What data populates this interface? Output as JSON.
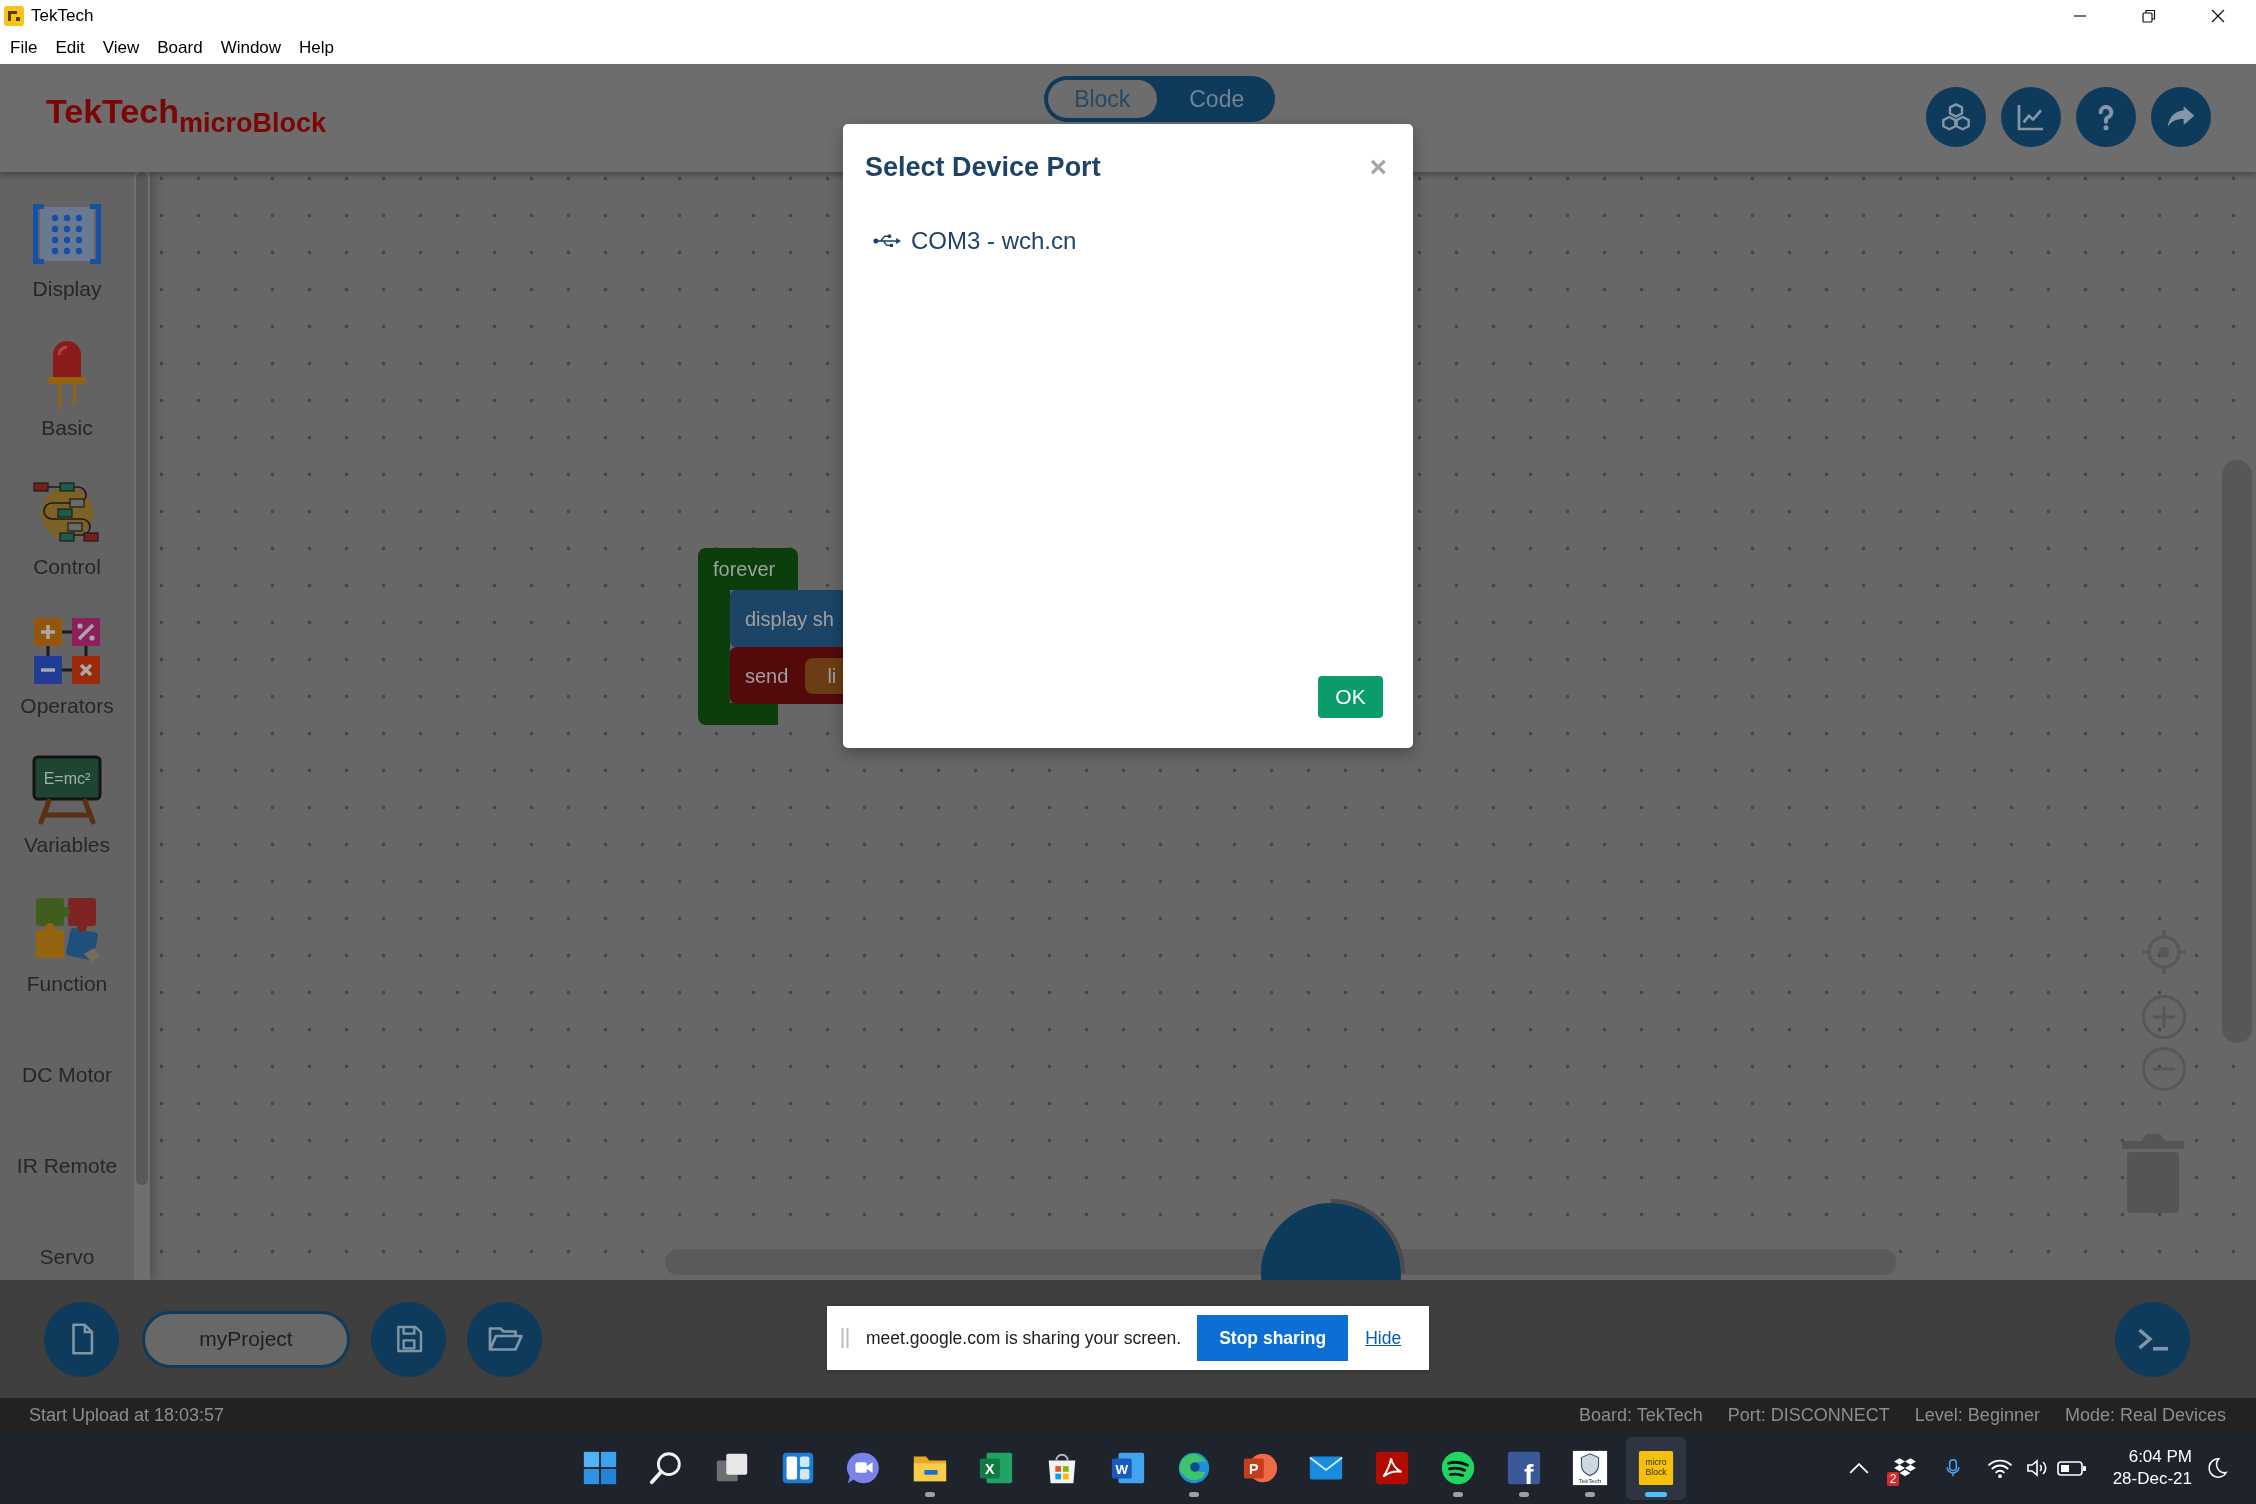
{
  "window": {
    "title": "TekTech"
  },
  "menu": [
    "File",
    "Edit",
    "View",
    "Board",
    "Window",
    "Help"
  ],
  "header": {
    "logo": "TekTech$_{microBlock}$",
    "mode_tabs": [
      {
        "label": "Block",
        "selected": true
      },
      {
        "label": "Code",
        "selected": false
      }
    ]
  },
  "sidebar": {
    "items": [
      {
        "kind": "icon",
        "label": "Display"
      },
      {
        "kind": "icon",
        "label": "Basic"
      },
      {
        "kind": "icon",
        "label": "Control"
      },
      {
        "kind": "icon",
        "label": "Operators"
      },
      {
        "kind": "icon",
        "label": "Variables",
        "icon_text": "E=mc²"
      },
      {
        "kind": "icon",
        "label": "Function"
      },
      {
        "kind": "plain",
        "label": "DC Motor"
      },
      {
        "kind": "plain",
        "label": "IR Remote"
      },
      {
        "kind": "plain",
        "label": "Servo"
      }
    ]
  },
  "workspace": {
    "blocks": [
      {
        "label": "forever",
        "color": "#0c3d0c",
        "children": [
          {
            "label": "display sh",
            "color": "#1b4466"
          },
          {
            "label": "send",
            "color": "#540a0a",
            "slot": {
              "label": "li",
              "color": "#6b3d14"
            }
          }
        ]
      }
    ]
  },
  "dialog": {
    "title": "Select Device Port",
    "close": "×",
    "ports": [
      {
        "label": "COM3 - wch.cn",
        "selected": false
      }
    ],
    "ok": "OK"
  },
  "toolbar": {
    "project_name": "myProject"
  },
  "screen_share": {
    "message": "meet.google.com is sharing your screen.",
    "stop": "Stop sharing",
    "hide": "Hide"
  },
  "status_bar": {
    "message": "Start Upload at 18:03:57",
    "items": [
      "Board: TekTech",
      "Port: DISCONNECT",
      "Level: Beginner",
      "Mode: Real Devices"
    ]
  },
  "taskbar": {
    "apps": [
      {
        "running": false,
        "selected": false
      },
      {
        "running": false,
        "selected": false
      },
      {
        "running": false,
        "selected": false
      },
      {
        "running": false,
        "selected": false
      },
      {
        "running": false,
        "selected": false
      },
      {
        "running": true,
        "selected": false
      },
      {
        "running": false,
        "selected": false,
        "icon_text": [
          "X"
        ]
      },
      {
        "running": false,
        "selected": false
      },
      {
        "running": false,
        "selected": false,
        "icon_text": [
          "W"
        ]
      },
      {
        "running": true,
        "selected": false
      },
      {
        "running": false,
        "selected": false,
        "icon_text": [
          "P"
        ]
      },
      {
        "running": false,
        "selected": false
      },
      {
        "running": false,
        "selected": false
      },
      {
        "running": true,
        "selected": false
      },
      {
        "running": true,
        "selected": false,
        "icon_text": [
          "f"
        ]
      },
      {
        "running": true,
        "selected": false,
        "icon_text": [
          "TekTech"
        ]
      },
      {
        "running": true,
        "selected": true,
        "icon_text": [
          "micro",
          "Block"
        ]
      }
    ],
    "tray": {
      "badge": "2",
      "time": "6:04 PM",
      "date": "28-Dec-21"
    }
  }
}
